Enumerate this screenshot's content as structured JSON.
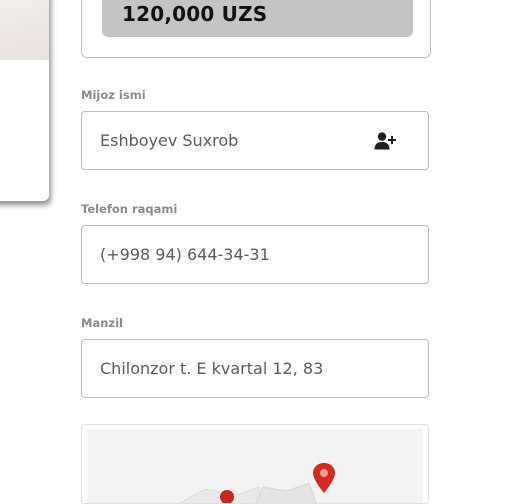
{
  "order": {
    "total_amount": "120,000 UZS"
  },
  "form": {
    "customer_name": {
      "label": "Mijoz ismi",
      "value": "Eshboyev Suxrob",
      "icon": "add-user-icon"
    },
    "phone": {
      "label": "Telefon raqami",
      "value": "(+998 94) 644-34-31"
    },
    "address": {
      "label": "Manzil",
      "value": "Chilonzor t. E kvartal 12, 83"
    }
  },
  "map": {
    "icon": "map-pin-icon",
    "pin_color": "#d6291f"
  }
}
